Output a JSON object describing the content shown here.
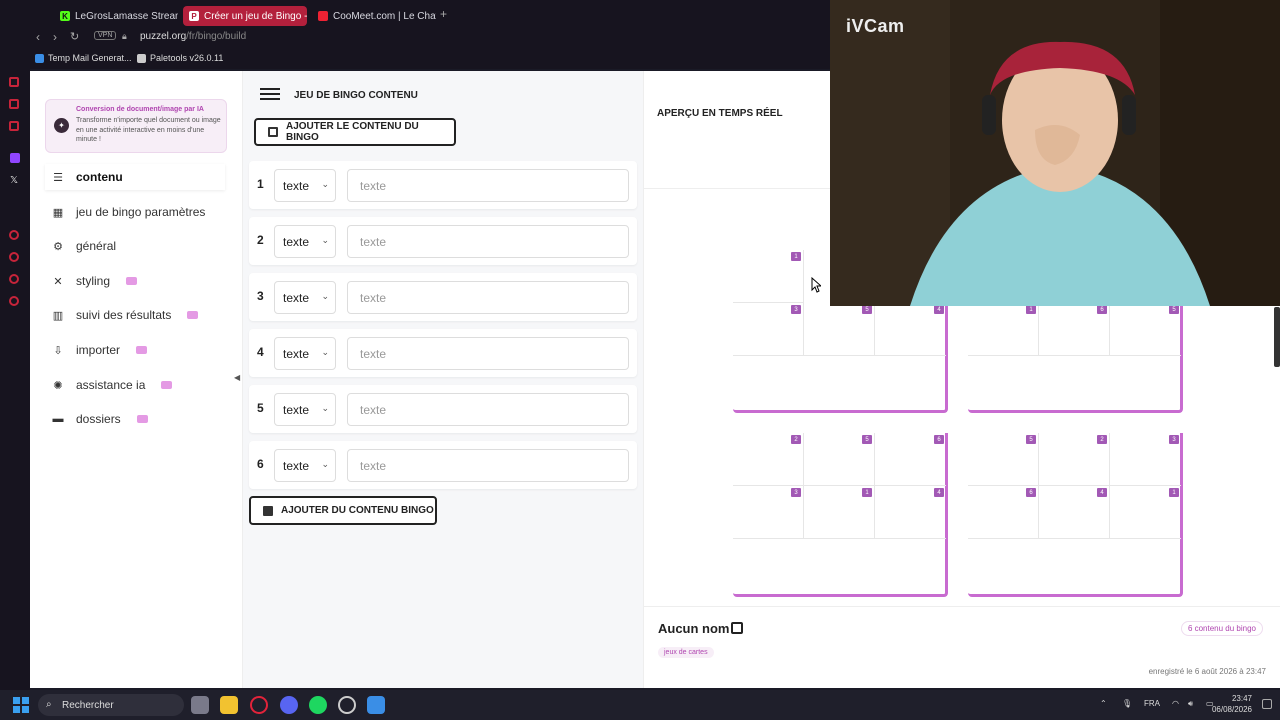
{
  "browser": {
    "tabs": [
      {
        "label": "LeGrosLamasse Stream - V"
      },
      {
        "label": "Créer un jeu de Bingo - En"
      },
      {
        "label": "CooMeet.com | Le Chat"
      }
    ],
    "vpn": "VPN",
    "url_host": "puzzel.org",
    "url_path": "/fr/bingo/build",
    "bookmarks": [
      {
        "label": "Temp Mail Generat..."
      },
      {
        "label": "Paletools v26.0.11"
      }
    ]
  },
  "sidebar": {
    "promo_title": "Conversion de document/image par IA",
    "promo_desc": "Transforme n'importe quel document ou image en une activité interactive en moins d'une minute !",
    "items": [
      {
        "label": "contenu"
      },
      {
        "label": "jeu de bingo paramètres"
      },
      {
        "label": "général"
      },
      {
        "label": "styling"
      },
      {
        "label": "suivi des résultats"
      },
      {
        "label": "importer"
      },
      {
        "label": "assistance ia"
      },
      {
        "label": "dossiers"
      }
    ]
  },
  "content": {
    "title": "JEU DE BINGO CONTENU",
    "add_content_button": "AJOUTER LE CONTENU DU BINGO",
    "add_more_button": "AJOUTER DU CONTENU BINGO",
    "rows": [
      {
        "num": "1",
        "type": "texte",
        "placeholder": "texte"
      },
      {
        "num": "2",
        "type": "texte",
        "placeholder": "texte"
      },
      {
        "num": "3",
        "type": "texte",
        "placeholder": "texte"
      },
      {
        "num": "4",
        "type": "texte",
        "placeholder": "texte"
      },
      {
        "num": "5",
        "type": "texte",
        "placeholder": "texte"
      },
      {
        "num": "6",
        "type": "texte",
        "placeholder": "texte"
      }
    ]
  },
  "preview": {
    "title": "APERÇU EN TEMPS RÉEL",
    "name": "Aucun nom",
    "count": "6 contenu du bingo",
    "tag": "jeux de cartes",
    "saved": "enregistré le 6 août 2026 à 23:47",
    "cards": [
      {
        "badges": [
          "1",
          "",
          "",
          "3",
          "5",
          "4"
        ]
      },
      {
        "badges": [
          "",
          "",
          "",
          "1",
          "6",
          "5"
        ]
      },
      {
        "badges": [
          "2",
          "5",
          "6",
          "3",
          "1",
          "4"
        ]
      },
      {
        "badges": [
          "5",
          "2",
          "3",
          "6",
          "4",
          "1"
        ]
      }
    ]
  },
  "cam": {
    "label": "iVCam"
  },
  "taskbar": {
    "search": "Rechercher",
    "lang": "FRA",
    "time": "23:47",
    "date": "06/08/2026"
  },
  "colors": {
    "accent": "#c86bd0",
    "badge": "#a259b5",
    "tab_active": "#b3203c"
  }
}
